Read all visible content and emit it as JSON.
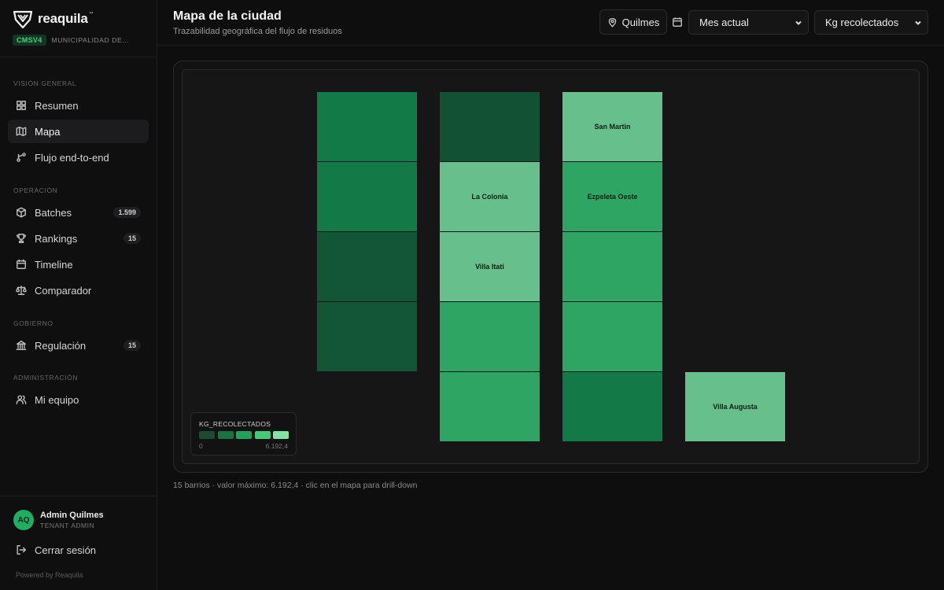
{
  "brand": {
    "name": "reaquila",
    "tm": "™"
  },
  "tenant": {
    "badge": "CMSV4",
    "name": "MUNICIPALIDAD DE QUILMES"
  },
  "sidebar": {
    "sections": [
      {
        "label": "VISIÓN GENERAL",
        "items": [
          {
            "label": "Resumen",
            "icon": "grid-icon"
          },
          {
            "label": "Mapa",
            "icon": "map-icon",
            "active": true
          },
          {
            "label": "Flujo end-to-end",
            "icon": "flow-icon"
          }
        ]
      },
      {
        "label": "OPERACIÓN",
        "items": [
          {
            "label": "Batches",
            "icon": "box-icon",
            "count": "1.599"
          },
          {
            "label": "Rankings",
            "icon": "trophy-icon",
            "count": "15"
          },
          {
            "label": "Timeline",
            "icon": "calendar-icon"
          },
          {
            "label": "Comparador",
            "icon": "scale-icon"
          }
        ]
      },
      {
        "label": "GOBIERNO",
        "items": [
          {
            "label": "Regulación",
            "icon": "landmark-icon",
            "count": "15"
          }
        ]
      },
      {
        "label": "ADMINISTRACIÓN",
        "items": [
          {
            "label": "Mi equipo",
            "icon": "users-icon"
          }
        ]
      }
    ]
  },
  "user": {
    "initials": "AQ",
    "name": "Admin Quilmes",
    "role": "TENANT ADMIN"
  },
  "logout_label": "Cerrar sesión",
  "powered_by": "Powered by Reaquila",
  "header": {
    "title": "Mapa de la ciudad",
    "subtitle": "Trazabilidad geográfica del flujo de residuos",
    "location": "Quilmes",
    "period": "Mes actual",
    "metric": "Kg recolectados"
  },
  "map": {
    "cells": [
      {
        "col": 0,
        "row": 0,
        "color": "#127a46",
        "label": ""
      },
      {
        "col": 0,
        "row": 1,
        "color": "#137a47",
        "label": ""
      },
      {
        "col": 0,
        "row": 2,
        "color": "#135636",
        "label": ""
      },
      {
        "col": 0,
        "row": 3,
        "color": "#135636",
        "label": ""
      },
      {
        "col": 1,
        "row": 0,
        "color": "#135134",
        "label": ""
      },
      {
        "col": 1,
        "row": 1,
        "color": "#67c08c",
        "label": "La Colonia"
      },
      {
        "col": 1,
        "row": 2,
        "color": "#67c08c",
        "label": "Villa Itati"
      },
      {
        "col": 1,
        "row": 3,
        "color": "#2fa563",
        "label": ""
      },
      {
        "col": 1,
        "row": 4,
        "color": "#2fa563",
        "label": ""
      },
      {
        "col": 2,
        "row": 0,
        "color": "#67c08c",
        "label": "San Martin"
      },
      {
        "col": 2,
        "row": 1,
        "color": "#2fa563",
        "label": "Ezpeleta Oeste"
      },
      {
        "col": 2,
        "row": 2,
        "color": "#2fa563",
        "label": ""
      },
      {
        "col": 2,
        "row": 3,
        "color": "#2fa563",
        "label": ""
      },
      {
        "col": 2,
        "row": 4,
        "color": "#137a47",
        "label": ""
      },
      {
        "col": 3,
        "row": 4,
        "color": "#67c08c",
        "label": "Villa Augusta"
      }
    ],
    "legend": {
      "title": "KG_RECOLECTADOS",
      "colors": [
        "#1d4a33",
        "#157440",
        "#1fa25c",
        "#3fcb7a",
        "#7fe3a6"
      ],
      "min": "0",
      "max": "6.192,4"
    }
  },
  "footnote": "15 barrios · valor máximo: 6.192,4 · clic en el mapa para drill-down"
}
